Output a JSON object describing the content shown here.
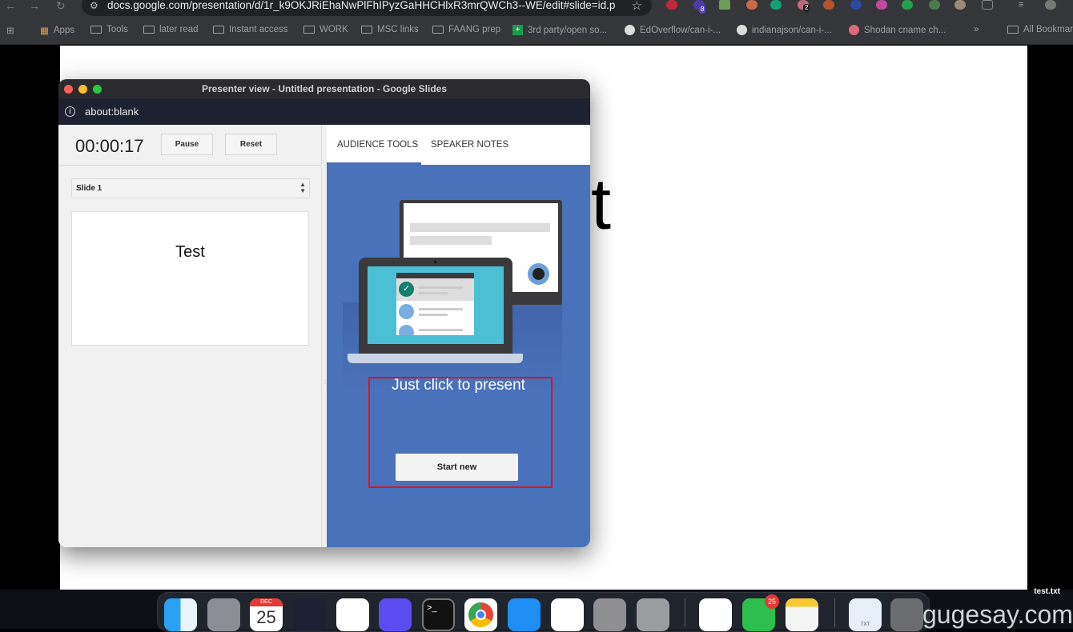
{
  "browser": {
    "url": "docs.google.com/presentation/d/1r_k9OKJRiEhaNwPlFhIPyzGaHHCHlxR3mrQWCh3--WE/edit#slide=id.p",
    "extension_badges": {
      "bitwarden": "8",
      "ext_count": "2"
    },
    "bookmarks": [
      {
        "label": "Apps",
        "icon": "apps-grid-icon"
      },
      {
        "label": "Tools",
        "icon": "folder-icon"
      },
      {
        "label": "later read",
        "icon": "folder-icon"
      },
      {
        "label": "Instant access",
        "icon": "folder-icon"
      },
      {
        "label": "WORK",
        "icon": "folder-icon"
      },
      {
        "label": "MSC links",
        "icon": "folder-icon"
      },
      {
        "label": "FAANG prep",
        "icon": "folder-icon"
      },
      {
        "label": "3rd party/open so...",
        "icon": "sheets-icon"
      },
      {
        "label": "EdOverflow/can-i-...",
        "icon": "github-icon"
      },
      {
        "label": "indianajson/can-i-...",
        "icon": "github-icon"
      },
      {
        "label": "Shodan cname ch...",
        "icon": "shodan-icon"
      }
    ],
    "more_bookmarks": "»",
    "all_bookmarks": "All Bookmarks"
  },
  "background_slide": {
    "visible_text": "t"
  },
  "presenter_window": {
    "title": "Presenter view - Untitled presentation - Google Slides",
    "address": "about:blank",
    "timer": "00:00:17",
    "pause_label": "Pause",
    "reset_label": "Reset",
    "slide_select": "Slide 1",
    "slide_thumbnail_text": "Test",
    "tabs": [
      {
        "label": "AUDIENCE TOOLS",
        "active": true
      },
      {
        "label": "SPEAKER NOTES",
        "active": false
      }
    ],
    "audience": {
      "headline": "Just click to present",
      "start_label": "Start new"
    }
  },
  "dock": {
    "calendar_month": "DEC",
    "calendar_day": "25",
    "whatsapp_badge": "25",
    "file_label": "TXT"
  },
  "desktop": {
    "file_name": "test.txt",
    "watermark": "gugesay.com"
  },
  "colors": {
    "accent_blue": "#4a72ba",
    "highlight_red": "#e0141e"
  }
}
